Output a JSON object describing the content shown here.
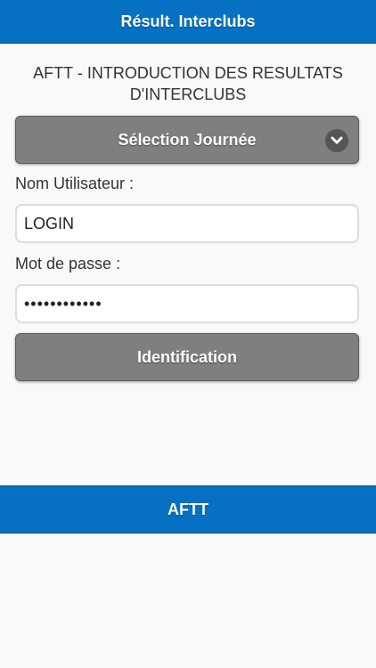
{
  "header": {
    "title": "Résult. Interclubs"
  },
  "intro": {
    "line1": "AFTT - INTRODUCTION DES RESULTATS",
    "line2": "D'INTERCLUBS"
  },
  "journee_select": {
    "label": "Sélection Journée",
    "icon": "chevron-down-icon"
  },
  "username": {
    "label": "Nom Utilisateur :",
    "value": "LOGIN"
  },
  "password": {
    "label": "Mot de passe :",
    "value": "••••••••••••"
  },
  "login_button": {
    "label": "Identification"
  },
  "footer": {
    "title": "AFTT"
  },
  "colors": {
    "brand_blue": "#0671c2",
    "button_gray": "#7f7f7f",
    "background": "#f9f9f9"
  }
}
